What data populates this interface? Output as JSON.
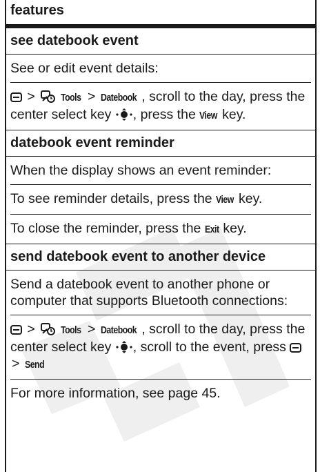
{
  "header": {
    "title": "features"
  },
  "sections": [
    {
      "title": "see datebook event",
      "intro": "See or edit event details:",
      "path": {
        "tools": "Tools",
        "datebook": "Datebook",
        "scroll": ", scroll to the day, press the center select key",
        "press": ", press the",
        "view": "View",
        "key": "key."
      }
    },
    {
      "title": "datebook event reminder",
      "intro": "When the display shows an event reminder:",
      "line1_pre": "To see reminder details, press the",
      "line1_key": "View",
      "line1_post": "key.",
      "line2_pre": "To close the reminder, press the",
      "line2_key": "Exit",
      "line2_post": "key."
    },
    {
      "title": "send datebook event to another device",
      "intro": "Send a datebook event to another phone or computer that supports Bluetooth connections:",
      "path": {
        "tools": "Tools",
        "datebook": "Datebook",
        "scroll": ", scroll to the day, press the center select key",
        "scroll2": ", scroll to the event, press",
        "send": "Send"
      },
      "more": "For more information, see page 45."
    }
  ],
  "icons": {
    "menu_key": "menu-key-icon",
    "tools": "tools-icon",
    "nav_key": "navigation-key-icon"
  },
  "colors": {
    "text": "#1a1a1a",
    "watermark": "#efefef"
  }
}
